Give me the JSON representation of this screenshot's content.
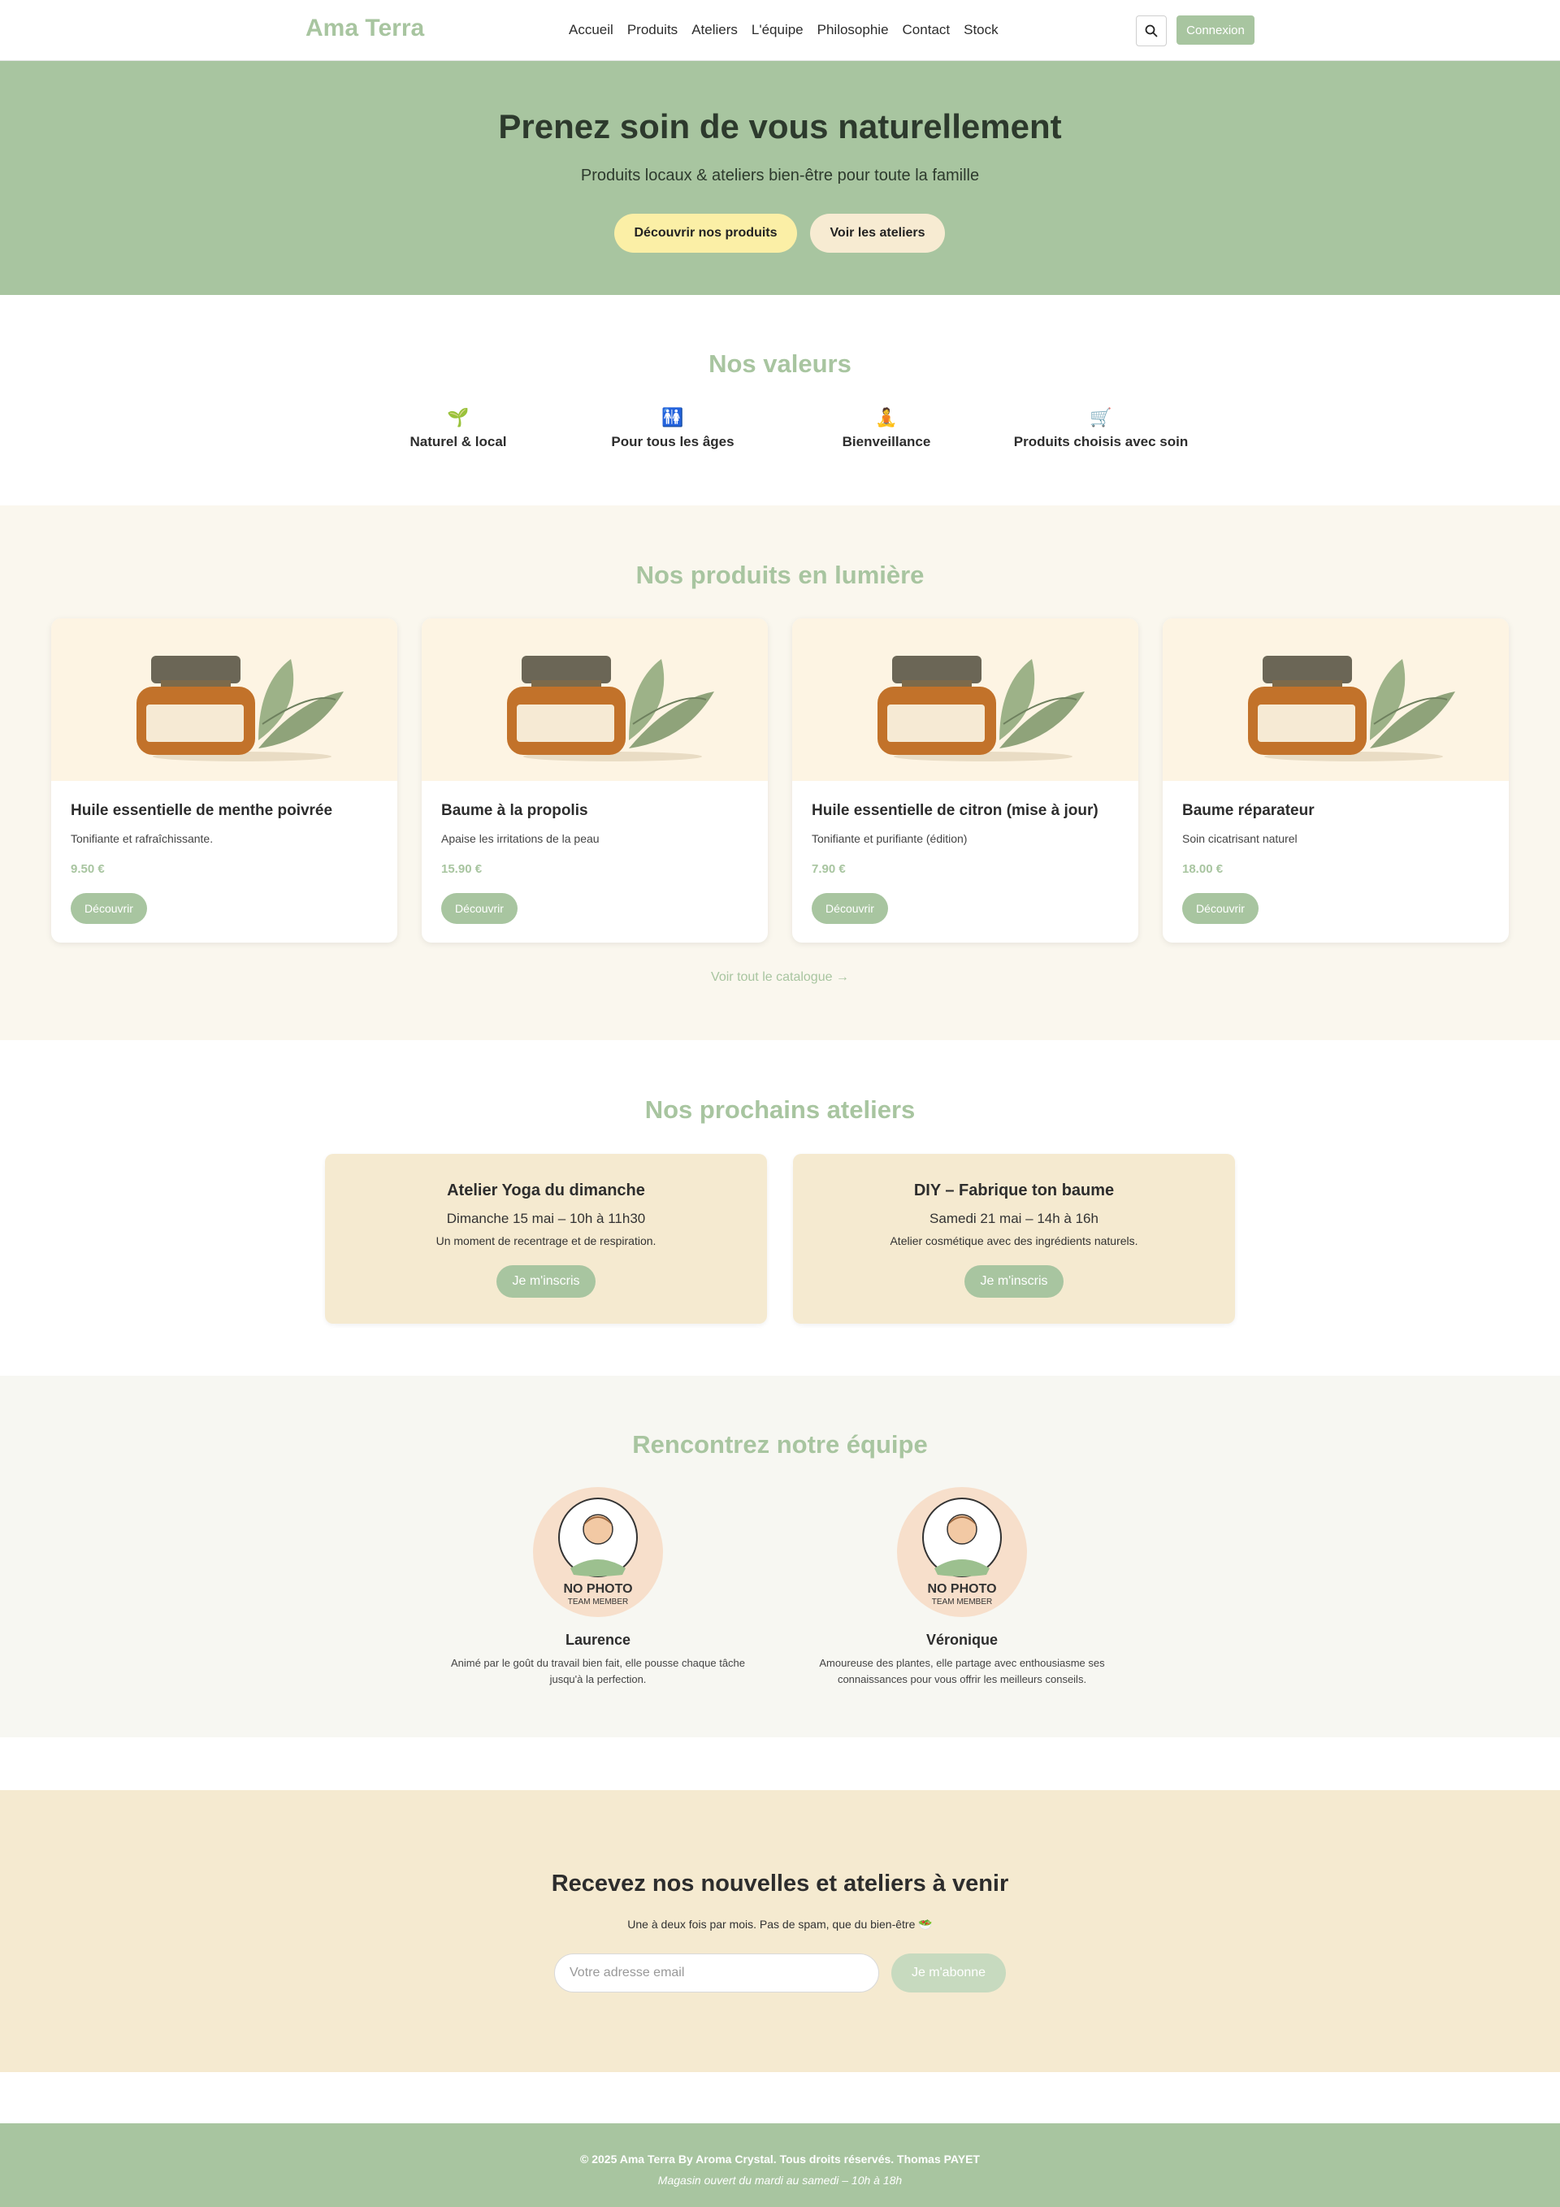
{
  "nav": {
    "logo": "Ama Terra",
    "links": [
      "Accueil",
      "Produits",
      "Ateliers",
      "L'équipe",
      "Philosophie",
      "Contact",
      "Stock"
    ],
    "search_icon": "search-icon",
    "login_label": "Connexion"
  },
  "hero": {
    "title": "Prenez soin de vous naturellement",
    "subtitle": "Produits locaux & ateliers bien-être pour toute la famille",
    "primary_button": "Découvrir nos produits",
    "secondary_button": "Voir les ateliers"
  },
  "values": {
    "title": "Nos valeurs",
    "items": [
      {
        "icon": "🌱",
        "icon_name": "seedling-icon",
        "label": "Naturel & local"
      },
      {
        "icon": "🚻",
        "icon_name": "family-icon",
        "label": "Pour tous les âges"
      },
      {
        "icon": "🧘",
        "icon_name": "meditation-icon",
        "label": "Bienveillance"
      },
      {
        "icon": "🛒",
        "icon_name": "cart-icon",
        "label": "Produits choisis avec soin"
      }
    ]
  },
  "products": {
    "title": "Nos produits en lumière",
    "items": [
      {
        "name": "Huile essentielle de menthe poivrée",
        "description": "Tonifiante et rafraîchissante.",
        "price": "9.50 €",
        "button": "Découvrir"
      },
      {
        "name": "Baume à la propolis",
        "description": "Apaise les irritations de la peau",
        "price": "15.90 €",
        "button": "Découvrir"
      },
      {
        "name": "Huile essentielle de citron (mise à jour)",
        "description": "Tonifiante et purifiante (édition)",
        "price": "7.90 €",
        "button": "Découvrir"
      },
      {
        "name": "Baume réparateur",
        "description": "Soin cicatrisant naturel",
        "price": "18.00 €",
        "button": "Découvrir"
      }
    ],
    "catalog_link": "Voir tout le catalogue →"
  },
  "workshops": {
    "title": "Nos prochains ateliers",
    "items": [
      {
        "title": "Atelier Yoga du dimanche",
        "date": "Dimanche 15 mai – 10h à 11h30",
        "description": "Un moment de recentrage et de respiration.",
        "button": "Je m'inscris"
      },
      {
        "title": "DIY – Fabrique ton baume",
        "date": "Samedi 21 mai – 14h à 16h",
        "description": "Atelier cosmétique avec des ingrédients naturels.",
        "button": "Je m'inscris"
      }
    ]
  },
  "team": {
    "title": "Rencontrez notre équipe",
    "photo_label": "NO PHOTO",
    "photo_sub": "TEAM MEMBER",
    "members": [
      {
        "name": "Laurence",
        "description": "Animé par le goût du travail bien fait, elle pousse chaque tâche jusqu'à la perfection."
      },
      {
        "name": "Véronique",
        "description": "Amoureuse des plantes, elle partage avec enthousiasme ses connaissances pour vous offrir les meilleurs conseils."
      }
    ]
  },
  "newsletter": {
    "title": "Recevez nos nouvelles et ateliers à venir",
    "subtitle": "Une à deux fois par mois. Pas de spam, que du bien-être 🥗",
    "placeholder": "Votre adresse email",
    "button": "Je m'abonne"
  },
  "footer": {
    "copyright": "© 2025 Ama Terra By Aroma Crystal. Tous droits réservés. Thomas PAYET",
    "hours": "Magasin ouvert du mardi au samedi – 10h à 18h"
  },
  "colors": {
    "accent": "#a8c5a0",
    "cream": "#f5ead0",
    "yellow_button": "#fbefa6"
  }
}
